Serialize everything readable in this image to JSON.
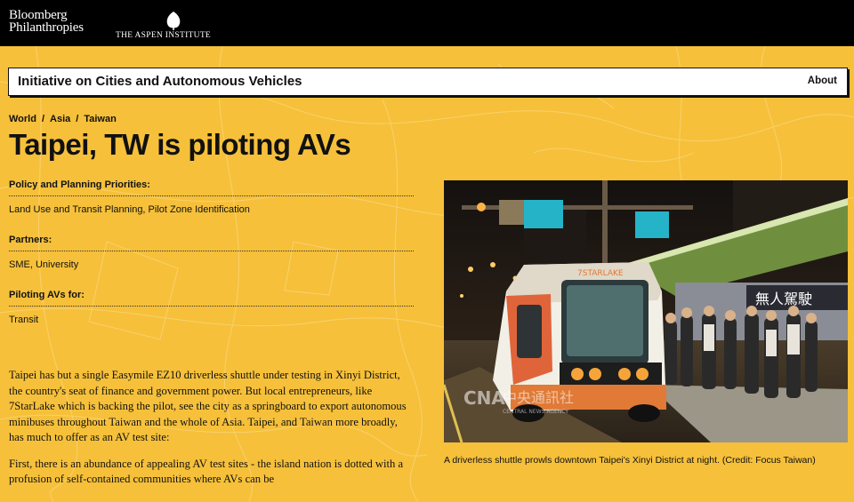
{
  "header": {
    "bloomberg_line1": "Bloomberg",
    "bloomberg_line2": "Philanthropies",
    "aspen_text": "THE ASPEN INSTITUTE"
  },
  "site": {
    "title": "Initiative on Cities and Autonomous Vehicles",
    "about_label": "About"
  },
  "breadcrumb": [
    "World",
    "Asia",
    "Taiwan"
  ],
  "page_title": "Taipei, TW is piloting AVs",
  "info": [
    {
      "label": "Policy and Planning Priorities:",
      "value": "Land Use and Transit Planning,  Pilot Zone Identification"
    },
    {
      "label": "Partners:",
      "value": "SME,  University"
    },
    {
      "label": "Piloting AVs for:",
      "value": "Transit"
    }
  ],
  "body_paragraphs": [
    "Taipei has but a single Easymile EZ10 driverless shuttle under testing in Xinyi District, the country's seat of finance and government power. But local entrepreneurs, like 7StarLake which is backing the pilot, see the city as a springboard to export autonomous minibuses throughout Taiwan and the whole of Asia. Taipei, and Taiwan more broadly, has much to offer as an AV test site:",
    "First, there is an abundance of appealing AV test sites - the island nation is dotted with a profusion of self-contained communities where AVs can be"
  ],
  "photo": {
    "shuttle_label": "7STARLAKE",
    "watermark": "中央通訊社",
    "watermark_sub": "CENTRAL NEWS AGENCY",
    "sign_text": "無人駕駛"
  },
  "caption": "A driverless shuttle prowls downtown Taipei's Xinyi District at night. (Credit: Focus Taiwan)",
  "colors": {
    "background": "#f6c03a",
    "topbar": "#000000",
    "text": "#111111"
  }
}
